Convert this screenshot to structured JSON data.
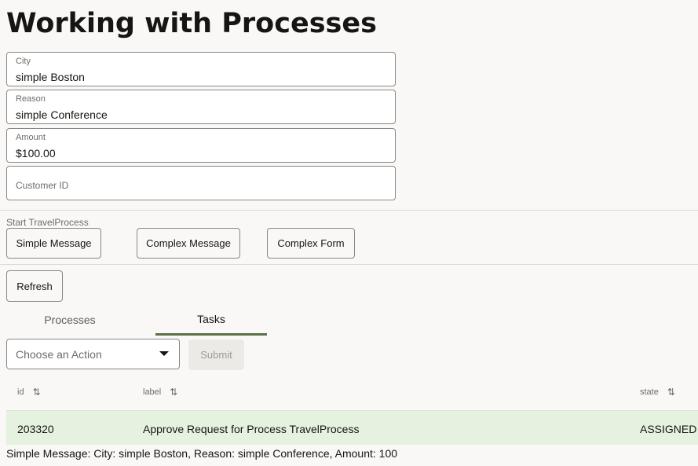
{
  "page": {
    "title": "Working with Processes"
  },
  "form": {
    "city": {
      "label": "City",
      "value": "simple Boston"
    },
    "reason": {
      "label": "Reason",
      "value": "simple Conference"
    },
    "amount": {
      "label": "Amount",
      "value": "$100.00"
    },
    "customer_id": {
      "placeholder": "Customer ID"
    }
  },
  "start": {
    "label": "Start TravelProcess",
    "buttons": [
      "Simple Message",
      "Complex Message",
      "Complex Form"
    ]
  },
  "refresh_label": "Refresh",
  "tabs": [
    {
      "label": "Processes",
      "active": false
    },
    {
      "label": "Tasks",
      "active": true
    }
  ],
  "action": {
    "placeholder": "Choose an Action",
    "submit_label": "Submit"
  },
  "table": {
    "columns": [
      "id",
      "label",
      "state"
    ],
    "rows": [
      {
        "id": "203320",
        "label": "Approve Request for Process TravelProcess",
        "state": "ASSIGNED"
      }
    ]
  },
  "message": "Simple Message: City: simple Boston, Reason: simple Conference, Amount: 100",
  "colors": {
    "tab_accent": "#5a7248",
    "row_highlight": "#e5f2df"
  },
  "icons": {
    "sort": "sort-arrows-icon",
    "dropdown": "chevron-down-icon"
  }
}
